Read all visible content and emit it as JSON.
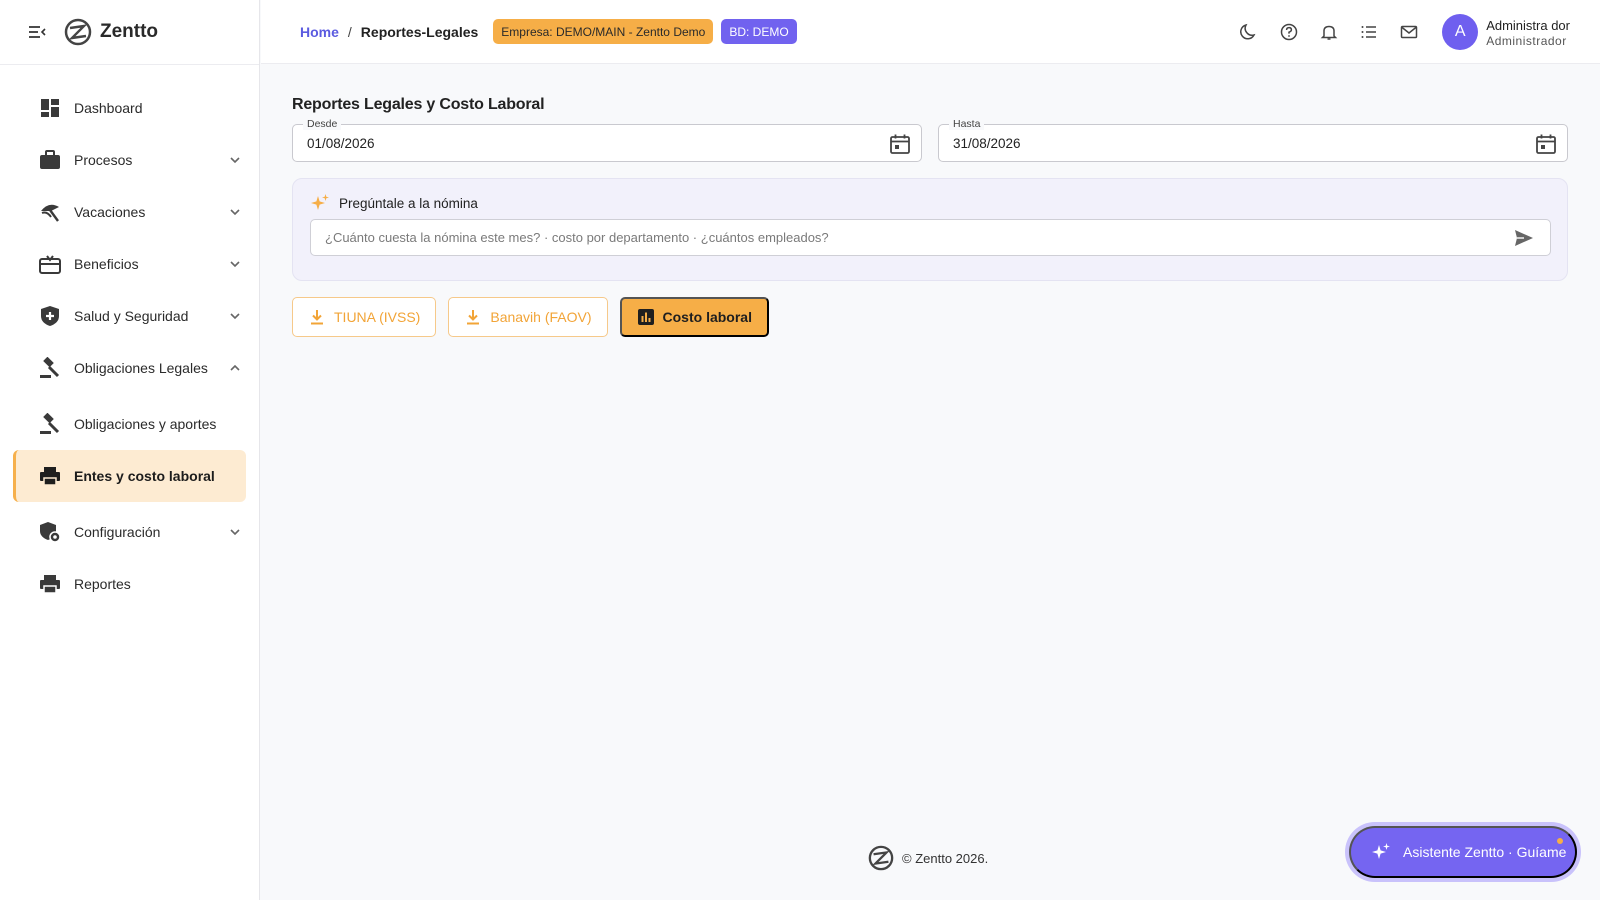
{
  "app": {
    "name": "Zentto"
  },
  "sidebar": {
    "items": [
      {
        "label": "Dashboard",
        "icon": "dashboard-icon"
      },
      {
        "label": "Procesos",
        "icon": "briefcase-icon"
      },
      {
        "label": "Vacaciones",
        "icon": "beach-icon"
      },
      {
        "label": "Beneficios",
        "icon": "gift-card-icon"
      },
      {
        "label": "Salud y Seguridad",
        "icon": "shield-plus-icon"
      },
      {
        "label": "Obligaciones Legales",
        "icon": "gavel-icon"
      },
      {
        "label": "Obligaciones y aportes",
        "icon": "gavel-icon"
      },
      {
        "label": "Entes y costo laboral",
        "icon": "printer-icon"
      },
      {
        "label": "Configuración",
        "icon": "admin-settings-icon"
      },
      {
        "label": "Reportes",
        "icon": "printer-icon"
      }
    ]
  },
  "topbar": {
    "breadcrumb": {
      "home": "Home",
      "separator": "/",
      "current": "Reportes-Legales"
    },
    "company_badge": "Empresa: DEMO/MAIN - Zentto Demo",
    "db_badge": "BD: DEMO",
    "user": {
      "initial": "A",
      "name": "Administra dor",
      "role": "Administrador"
    }
  },
  "page": {
    "title": "Reportes Legales y Costo Laboral",
    "from": {
      "label": "Desde",
      "value": "01/08/2026"
    },
    "to": {
      "label": "Hasta",
      "value": "31/08/2026"
    },
    "ask": {
      "title": "Pregúntale a la nómina",
      "placeholder": "¿Cuánto cuesta la nómina este mes? · costo por departamento · ¿cuántos empleados?"
    },
    "buttons": {
      "tiuna": "TIUNA (IVSS)",
      "banavih": "Banavih (FAOV)",
      "costo": "Costo laboral"
    }
  },
  "footer": {
    "text": "© Zentto 2026."
  },
  "assistant": {
    "label": "Asistente Zentto · Guíame"
  },
  "colors": {
    "accent": "#f6ae47",
    "primary": "#6f5fef",
    "active_bg": "#fdebd2"
  }
}
